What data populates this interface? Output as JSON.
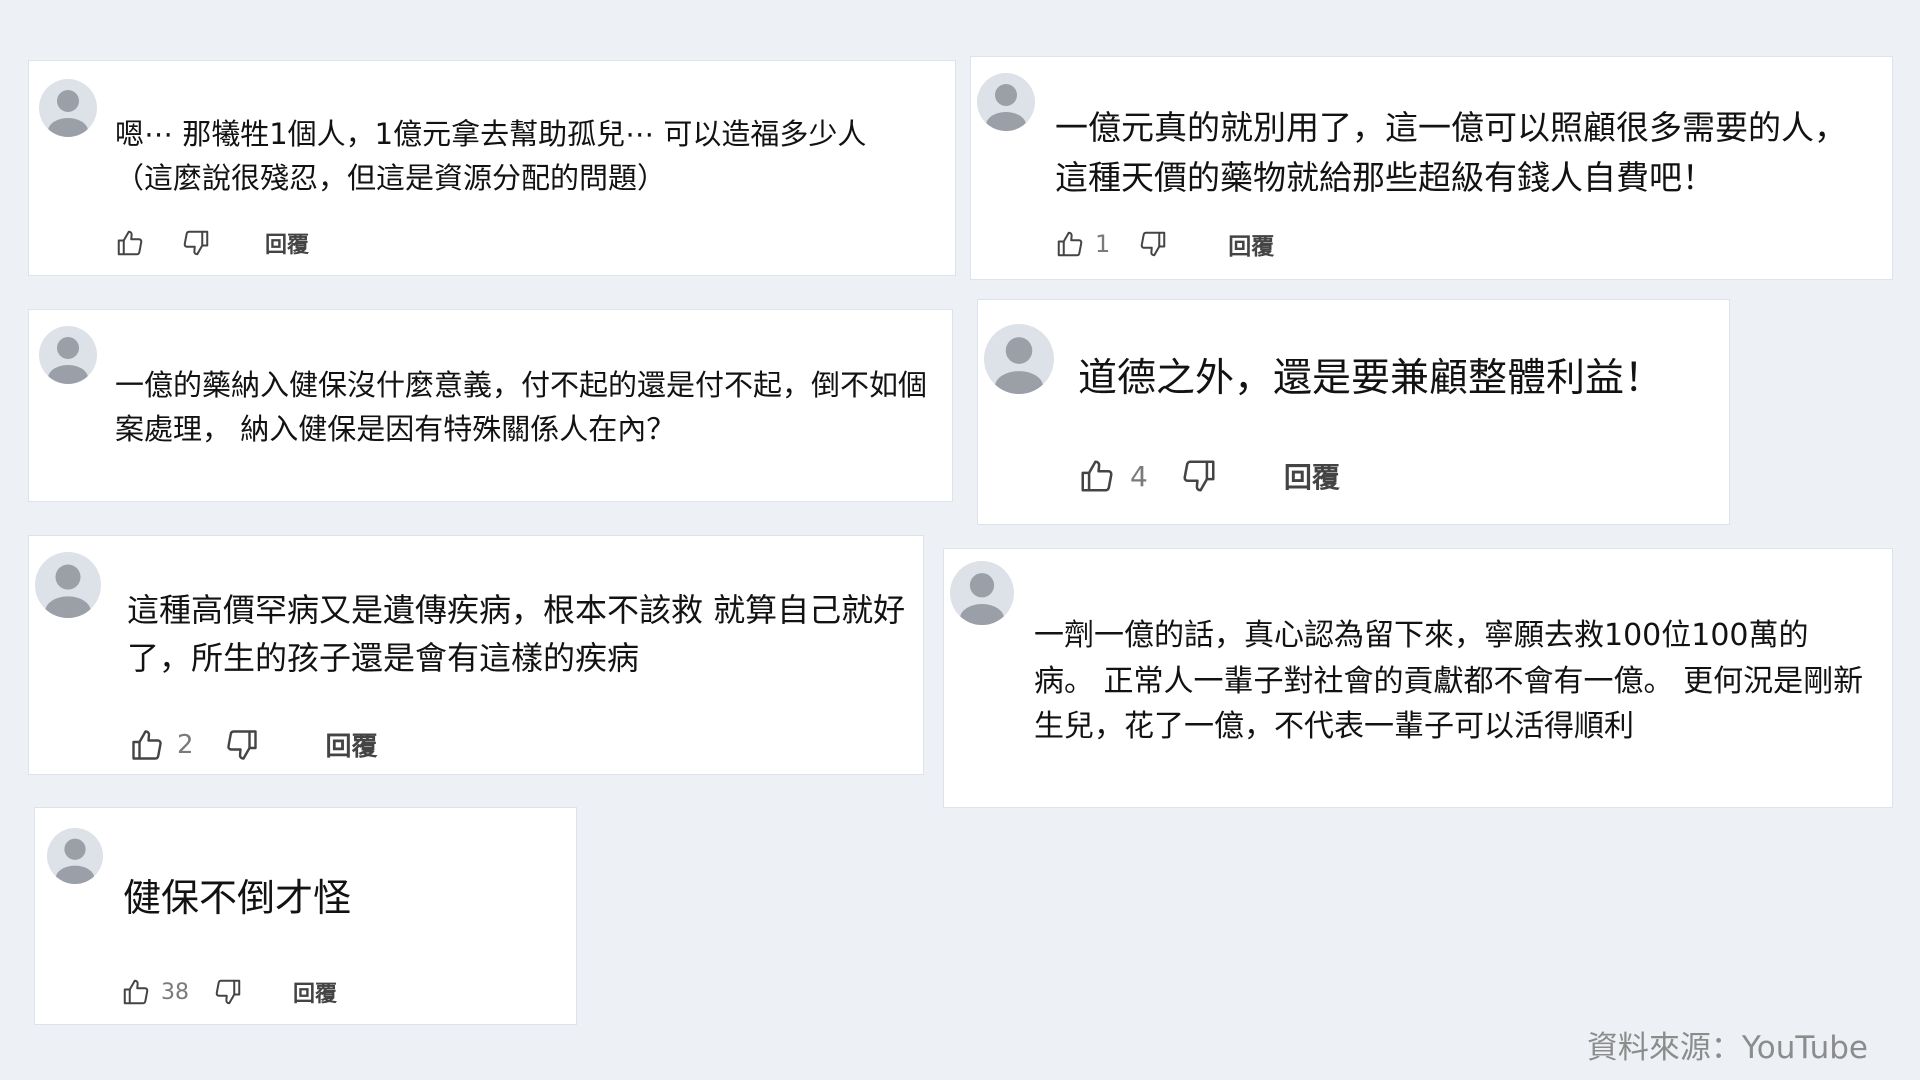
{
  "comments": [
    {
      "text": "嗯⋯ 那犧牲1個人，1億元拿去幫助孤兒⋯ 可以造福多少人 （這麼說很殘忍，但這是資源分配的問題）",
      "likes": "",
      "reply": "回覆"
    },
    {
      "text": "一億元真的就別用了，這一億可以照顧很多需要的人，這種天價的藥物就給那些超級有錢人自費吧！",
      "likes": "1",
      "reply": "回覆"
    },
    {
      "text": "一億的藥納入健保沒什麼意義，付不起的還是付不起，倒不如個案處理， 納入健保是因有特殊關係人在內？",
      "likes": "",
      "reply": ""
    },
    {
      "text": "道德之外，還是要兼顧整體利益！",
      "likes": "4",
      "reply": "回覆"
    },
    {
      "text": "這種高價罕病又是遺傳疾病，根本不該救 就算自己就好了，所生的孩子還是會有這樣的疾病",
      "likes": "2",
      "reply": "回覆"
    },
    {
      "text": "一劑一億的話，真心認為留下來，寧願去救100位100萬的病。 正常人一輩子對社會的貢獻都不會有一億。 更何況是剛新生兒，花了一億，不代表一輩子可以活得順利",
      "likes": "",
      "reply": ""
    },
    {
      "text": "健保不倒才怪",
      "likes": "38",
      "reply": "回覆"
    }
  ],
  "source": "資料來源：YouTube"
}
